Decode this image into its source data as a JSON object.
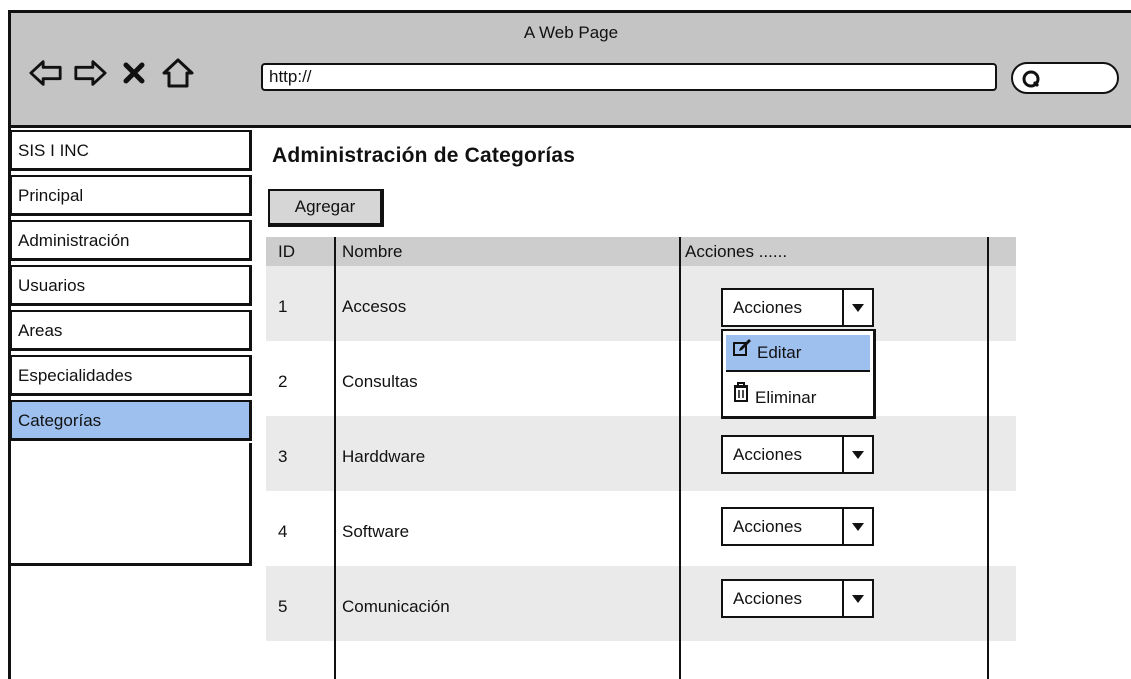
{
  "browser": {
    "title": "A Web Page",
    "url": "http://"
  },
  "sidebar": {
    "items": [
      {
        "label": "SIS I INC"
      },
      {
        "label": "Principal"
      },
      {
        "label": "Administración"
      },
      {
        "label": "Usuarios"
      },
      {
        "label": "Areas"
      },
      {
        "label": "Especialidades"
      },
      {
        "label": "Categorías",
        "active": true
      }
    ]
  },
  "main": {
    "title": "Administración de Categorías",
    "add_button": "Agregar",
    "table": {
      "headers": [
        "ID",
        "Nombre",
        "Acciones ......"
      ],
      "rows": [
        {
          "id": "1",
          "name": "Accesos",
          "action": "Acciones"
        },
        {
          "id": "2",
          "name": "Consultas",
          "action": ""
        },
        {
          "id": "3",
          "name": "Harddware",
          "action": "Acciones"
        },
        {
          "id": "4",
          "name": "Software",
          "action": "Acciones"
        },
        {
          "id": "5",
          "name": "Comunicación",
          "action": "Acciones"
        }
      ]
    },
    "action_menu": {
      "items": [
        "Editar",
        "Eliminar"
      ],
      "highlight_color": "#9ec0ee"
    }
  },
  "colors": {
    "browser_bar": "#c4c4c4",
    "active_item": "#9ec0ee",
    "header_row": "#cdcdcd",
    "stripe": "#eaeaea"
  }
}
